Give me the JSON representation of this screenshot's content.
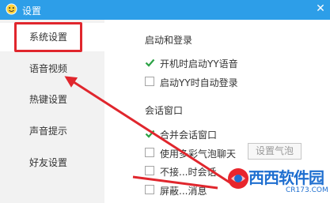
{
  "window": {
    "title": "设置"
  },
  "sidebar": {
    "items": [
      {
        "label": "系统设置"
      },
      {
        "label": "语音视频"
      },
      {
        "label": "热键设置"
      },
      {
        "label": "声音提示"
      },
      {
        "label": "好友设置"
      }
    ]
  },
  "startup": {
    "title": "启动和登录",
    "options": [
      {
        "label": "开机时启动YY语音",
        "checked": true
      },
      {
        "label": "启动YY时自动登录",
        "checked": false
      }
    ]
  },
  "chat": {
    "title": "会话窗口",
    "options": [
      {
        "label": "合并会话窗口",
        "checked": true
      },
      {
        "label": "使用多彩气泡聊天",
        "checked": false
      },
      {
        "label": "不接...时会话",
        "checked": false
      },
      {
        "label": "屏蔽...消息",
        "checked": false
      }
    ],
    "bubble_button": "设置气泡"
  },
  "watermark": {
    "text": "西西软件园",
    "url": "CR173.COM"
  },
  "colors": {
    "titlebar": "#2d9ee8",
    "highlight": "#e0262d",
    "check": "#2ba245"
  }
}
